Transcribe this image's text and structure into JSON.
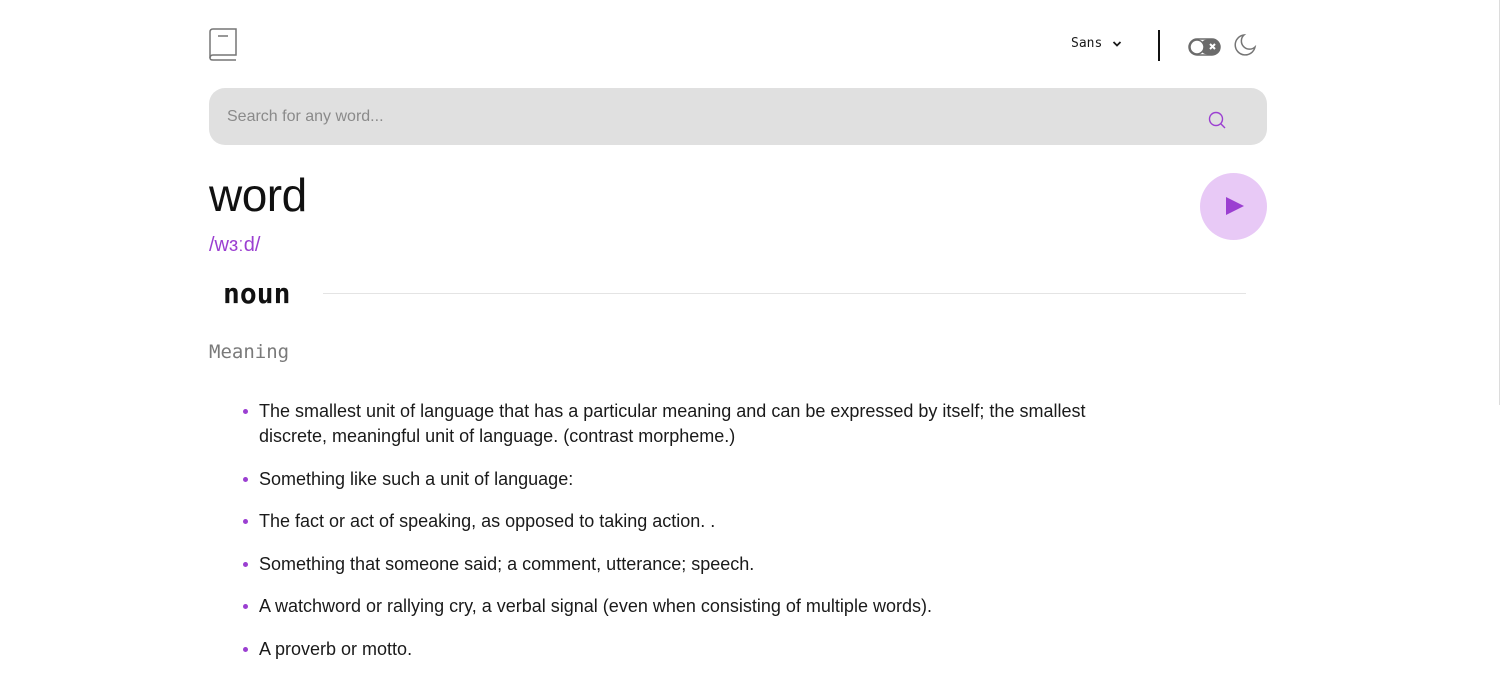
{
  "header": {
    "logo_icon": "book-icon",
    "font_select": {
      "value": "Sans",
      "icon": "chevron-down-icon"
    },
    "theme_toggle": {
      "icon": "toggle-icon"
    },
    "theme_icon": "moon-icon"
  },
  "search": {
    "value": "",
    "placeholder": "Search for any word...",
    "icon": "search-icon"
  },
  "entry": {
    "word": "word",
    "phonetic": "/wɜːd/",
    "play_icon": "play-icon",
    "part_of_speech": "noun",
    "meaning_label": "Meaning",
    "definitions": [
      "The smallest unit of language that has a particular meaning and can be expressed by itself; the smallest discrete, meaningful unit of language. (contrast morpheme.)",
      "Something like such a unit of language:",
      "The fact or act of speaking, as opposed to taking action. .",
      "Something that someone said; a comment, utterance; speech.",
      "A watchword or rallying cry, a verbal signal (even when consisting of multiple words).",
      "A proverb or motto."
    ]
  },
  "colors": {
    "accent": "#9b3fd1",
    "play_bg": "#e8c9f6",
    "search_bg": "#e0e0e0"
  }
}
